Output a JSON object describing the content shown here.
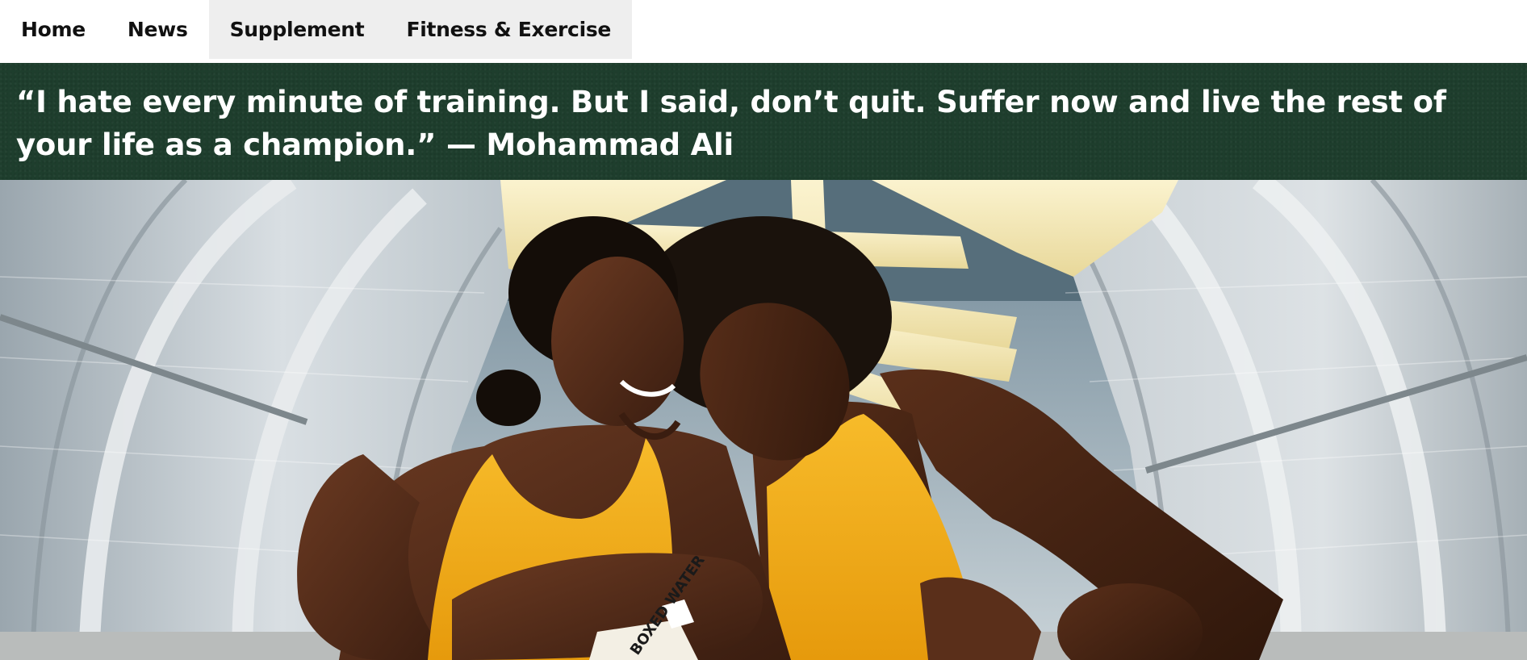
{
  "nav": {
    "items": [
      {
        "label": "Home"
      },
      {
        "label": "News"
      },
      {
        "label": "Supplement"
      },
      {
        "label": "Fitness & Exercise"
      }
    ]
  },
  "quote": {
    "text": "“I hate every minute of training. But I said, don’t quit. Suffer now and live the rest of your life as a champion.” — Mohammad Ali"
  },
  "hero": {
    "alt": "Two smiling women in yellow athletic tops sitting together inside a glass pedestrian bridge",
    "bottle_label": "BOXED WATER"
  },
  "colors": {
    "banner_bg": "#1e3e2d",
    "nav_group_bg": "#eeeeee",
    "top_yellow": "#f5b21c"
  }
}
